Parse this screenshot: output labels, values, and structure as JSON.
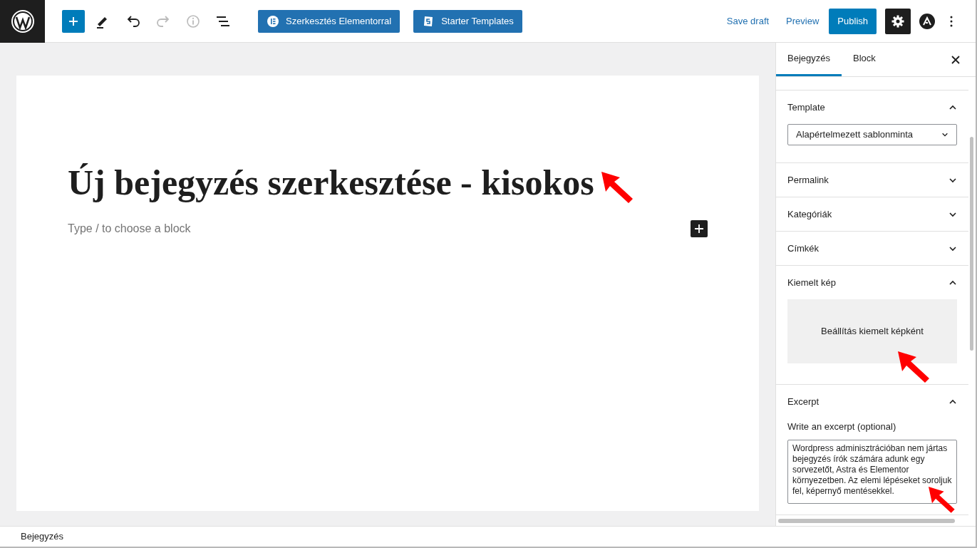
{
  "toolbar": {
    "buttons": [
      {
        "label": "Szerkesztés Elementorral",
        "kind": "elementor"
      },
      {
        "label": "Starter Templates",
        "kind": "starter"
      }
    ],
    "redo_disabled": true,
    "save_draft": "Save draft",
    "preview": "Preview",
    "publish": "Publish",
    "settings_active": true
  },
  "editor": {
    "title": "Új bejegyzés szerkesztése - kisokos",
    "placeholder": "Type / to choose a block"
  },
  "sidebar": {
    "tabs": [
      {
        "label": "Bejegyzés",
        "selected": true
      },
      {
        "label": "Block",
        "selected": false
      }
    ],
    "panels": [
      {
        "kind": "select",
        "title": "Template",
        "expanded": true,
        "value": "Alapértelmezett sablonminta"
      },
      {
        "kind": "plain",
        "title": "Permalink",
        "expanded": false
      },
      {
        "kind": "plain",
        "title": "Kategóriák",
        "expanded": false
      },
      {
        "kind": "plain",
        "title": "Címkék",
        "expanded": false
      },
      {
        "kind": "image",
        "title": "Kiemelt kép",
        "expanded": true,
        "button": "Beállítás kiemelt képként"
      },
      {
        "kind": "textarea",
        "title": "Excerpt",
        "expanded": true,
        "label": "Write an excerpt (optional)",
        "value": "Wordpress adminisztrációban nem jártas bejegyzés írók számára adunk egy sorvezetőt, Astra és Elementor környezetben. Az elemi lépéseket soroljuk fel, képernyő mentésekkel."
      }
    ]
  },
  "status_bar": {
    "breadcrumb": "Bejegyzés"
  }
}
